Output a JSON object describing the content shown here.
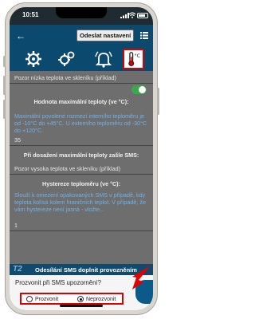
{
  "status_bar": {
    "time": "10:51"
  },
  "toolbar": {
    "send_settings_label": "Odeslat nastavení"
  },
  "tabs": [
    {
      "icon": "settings-gear-icon"
    },
    {
      "icon": "settings-gears-icon"
    },
    {
      "icon": "bell-icon"
    },
    {
      "icon": "thermometer-icon",
      "active": true
    }
  ],
  "content": {
    "low_sms_text": "Pozor nízka teplota ve skleníku (příklad)",
    "max_temp_heading": "Hodnota maximální teploty (ve °C):",
    "max_temp_help": "Maximální povolené rozmezí interního teploměru je od -10°C do +45°C. U externího teploměru od -30°C do +120°C.",
    "max_temp_value": "35",
    "exceed_sms_heading": "Při dosažení maximální teploty zašle SMS:",
    "exceed_sms_text": "Pozor vysoka teplota ve skleníku (příklad)",
    "hysteresis_heading": "Hystereze teploměru (ve °C):",
    "hysteresis_help": "Slouží k omezení opakovaných SMS v případě, kdy teplota kolísá kolem hraničních teplot. V případě, že vám hystereze není jasná - vložte...",
    "hysteresis_value": "1"
  },
  "section": {
    "tag": "T2",
    "title": "Odesílání SMS doplnit provozněním"
  },
  "dialog": {
    "question": "Prozvonit při SMS upozornění?",
    "options": [
      {
        "label": "Prozvonit",
        "selected": false
      },
      {
        "label": "Neprozvonit",
        "selected": true
      }
    ]
  },
  "colors": {
    "accent": "#0b4a6e",
    "highlight": "#dd0000",
    "toggle_on": "#3aa84c",
    "help_text": "#6db2ea"
  }
}
